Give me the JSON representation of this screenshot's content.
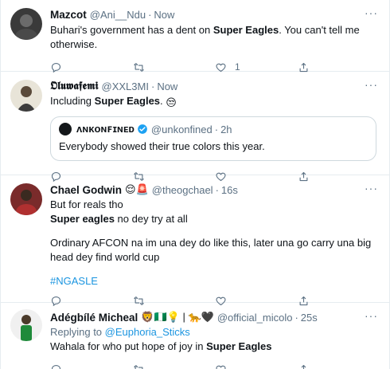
{
  "tweets": [
    {
      "name": "Mazcot",
      "handle": "@Ani__Ndu",
      "time": "Now",
      "text_pre": "Buhari's government has a dent on ",
      "text_bold": "Super Eagles",
      "text_post": ". You can't tell me otherwise.",
      "like_count": "1"
    },
    {
      "name": "𝕺𝖑𝖚𝖜𝖆𝖋𝖊𝖒𝖎",
      "handle": "@XXL3MI",
      "time": "Now",
      "text_pre": "Including ",
      "text_bold": "Super Eagles",
      "text_post": ".",
      "emoji": "😒",
      "quote": {
        "name": "ʌɴᴋᴏɴꜰɪɴᴇᴅ",
        "handle": "@unkonfined",
        "time": "2h",
        "text": "Everybody showed their true colors this year."
      }
    },
    {
      "name": "Chael Godwin",
      "name_emojis": "😌🚨",
      "handle": "@theogchael",
      "time": "16s",
      "line1": "But for reals tho",
      "line2_bold": "Super eagles",
      "line2_post": " no dey try at all",
      "para2": "Ordinary AFCON na im una dey do like this, later una go carry una big head dey find world cup",
      "hashtag": "#NGASLE"
    },
    {
      "name": "Adégbílé Micheal",
      "name_emojis": "🦁🇳🇬💡 | 🐆🖤",
      "handle": "@official_micolo",
      "time": "25s",
      "replying_label": "Replying to ",
      "replying_to": "@Euphoria_Sticks",
      "text_pre": "Wahala for who put hope of joy in ",
      "text_bold": "Super Eagles"
    }
  ],
  "colors": {
    "text": "#0f1419",
    "secondary": "#5b7083",
    "link": "#1b95e0",
    "border": "#e6ecf0",
    "verified": "#1da1f2"
  },
  "icons": [
    "reply-icon",
    "retweet-icon",
    "like-icon",
    "share-icon",
    "more-icon",
    "verified-icon"
  ]
}
